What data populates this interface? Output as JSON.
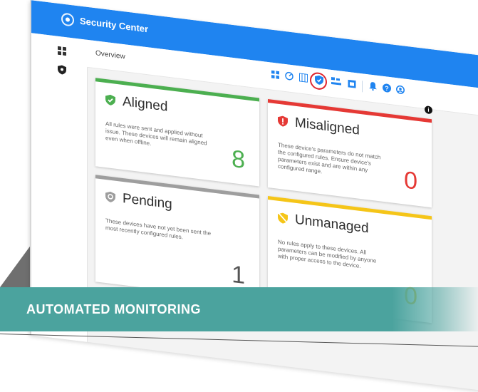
{
  "app": {
    "title": "Security Center"
  },
  "toolbar": {
    "section_label": "Overview"
  },
  "colors": {
    "brand": "#1f84f0",
    "aligned": "#4caf50",
    "misaligned": "#e53935",
    "pending": "#9e9e9e",
    "unmanaged": "#f5c518",
    "banner": "#4ba39e",
    "highlight": "#e0262f"
  },
  "cards": {
    "aligned": {
      "title": "Aligned",
      "description": "All rules were sent and applied without issue. These devices will remain aligned even when offline.",
      "count": "8",
      "icon": "shield-check-icon"
    },
    "misaligned": {
      "title": "Misaligned",
      "description": "These device's parameters do not match the configured rules. Ensure device's parameters exist and are within any configured range.",
      "count": "0",
      "icon": "shield-alert-icon"
    },
    "pending": {
      "title": "Pending",
      "description": "These devices have not yet been sent the most recently configured rules.",
      "count": "1",
      "icon": "shield-pending-icon"
    },
    "unmanaged": {
      "title": "Unmanaged",
      "description": "No rules apply to these devices. All parameters can be modified by anyone with proper access to the device.",
      "count": "0",
      "icon": "shield-off-icon"
    }
  },
  "banner": {
    "text": "AUTOMATED MONITORING"
  }
}
